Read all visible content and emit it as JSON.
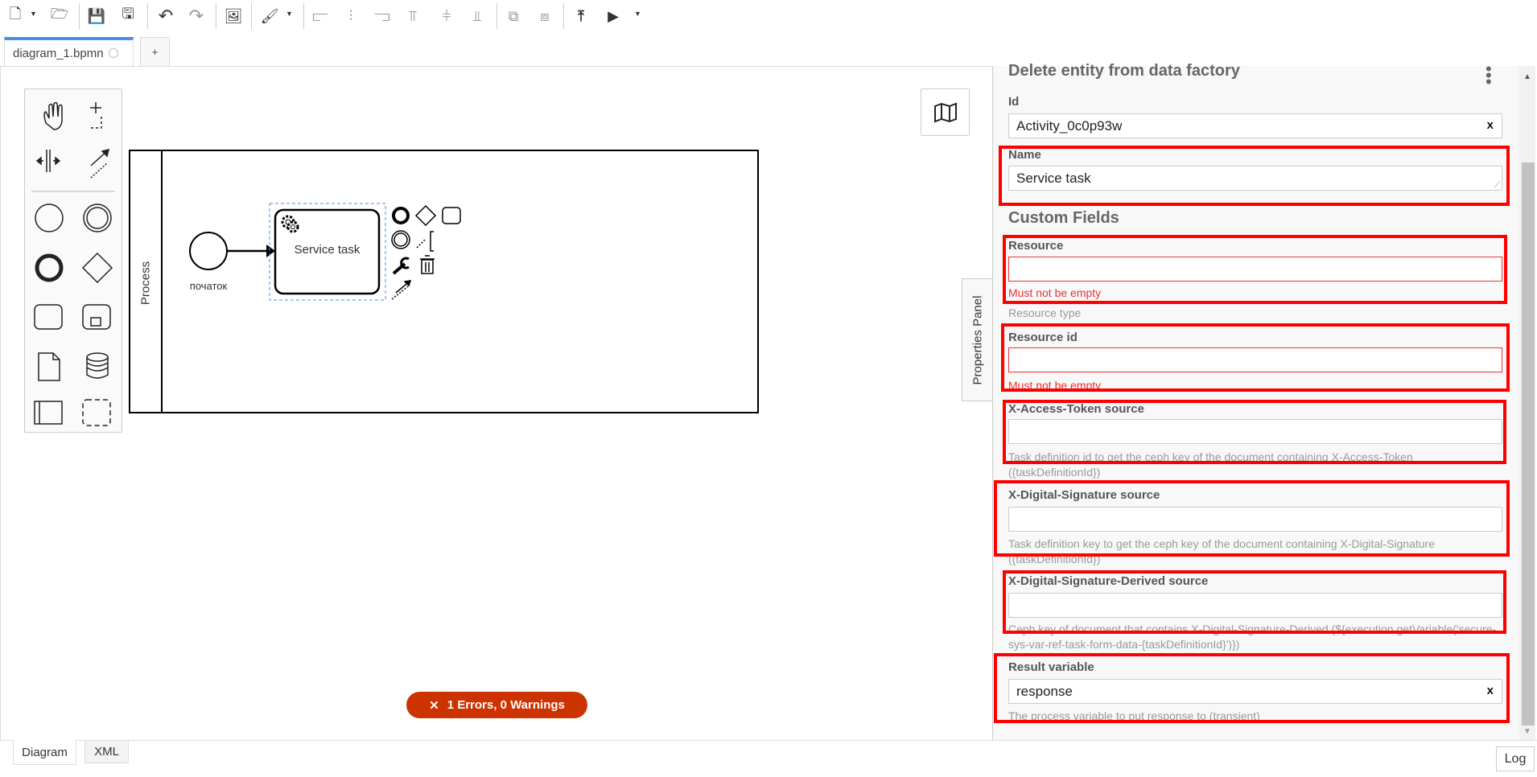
{
  "toolbar": {
    "items": [
      {
        "name": "new-file-icon",
        "glyph": "🗋"
      },
      {
        "name": "open-folder-icon",
        "glyph": "🗁"
      },
      {
        "name": "save-icon",
        "glyph": "💾"
      },
      {
        "name": "save-as-icon",
        "glyph": "🖫"
      },
      {
        "name": "undo-icon",
        "glyph": "↶"
      },
      {
        "name": "redo-icon",
        "glyph": "↷"
      },
      {
        "name": "export-image-icon",
        "glyph": "🖼"
      },
      {
        "name": "color-brush-icon",
        "glyph": "🖌"
      },
      {
        "name": "align-left-icon",
        "glyph": "⫍"
      },
      {
        "name": "align-center-icon",
        "glyph": "⫶"
      },
      {
        "name": "align-right-icon",
        "glyph": "⫎"
      },
      {
        "name": "align-top-icon",
        "glyph": "⫪"
      },
      {
        "name": "align-middle-icon",
        "glyph": "⫩"
      },
      {
        "name": "align-bottom-icon",
        "glyph": "⫫"
      },
      {
        "name": "distribute-horizontal-icon",
        "glyph": "⧉"
      },
      {
        "name": "distribute-vertical-icon",
        "glyph": "⧈"
      },
      {
        "name": "deploy-icon",
        "glyph": "⤒"
      },
      {
        "name": "run-icon",
        "glyph": "▶"
      }
    ]
  },
  "tabs": [
    {
      "label": "diagram_1.bpmn"
    },
    {
      "label": "+"
    }
  ],
  "diagram": {
    "pool_label": "Process",
    "start_event_label": "початок",
    "task_label": "Service task"
  },
  "errors_badge": "1 Errors, 0 Warnings",
  "bottom_tabs": {
    "diagram": "Diagram",
    "xml": "XML"
  },
  "log_button": "Log",
  "properties_toggle": "Properties Panel",
  "panel": {
    "title": "Delete entity from data factory",
    "id_label": "Id",
    "id_value": "Activity_0c0p93w",
    "name_label": "Name",
    "name_value": "Service task",
    "section": "Custom Fields",
    "resource_label": "Resource",
    "resource_error": "Must not be empty",
    "resource_type": "Resource type",
    "resource_id_label": "Resource id",
    "resource_id_error": "Must not be empty",
    "xat_label": "X-Access-Token source",
    "xat_desc": "Task definition id to get the ceph key of the document containing X-Access-Token ({taskDefinitionId})",
    "xds_label": "X-Digital-Signature source",
    "xds_desc": "Task definition key to get the ceph key of the document containing X-Digital-Signature ({taskDefinitionId})",
    "xdsd_label": "X-Digital-Signature-Derived source",
    "xdsd_desc": "Ceph key of document that contains X-Digital-Signature-Derived (${execution.getVariable('secure-sys-var-ref-task-form-data-{taskDefinitionId}')})",
    "result_label": "Result variable",
    "result_value": "response",
    "result_desc": "The process variable to put response to (transient)",
    "clear_glyph": "x"
  },
  "colors": {
    "highlight": "#ff0000",
    "error": "#e33333",
    "badge": "#cc3300",
    "tab_accent": "#4a90e2"
  }
}
